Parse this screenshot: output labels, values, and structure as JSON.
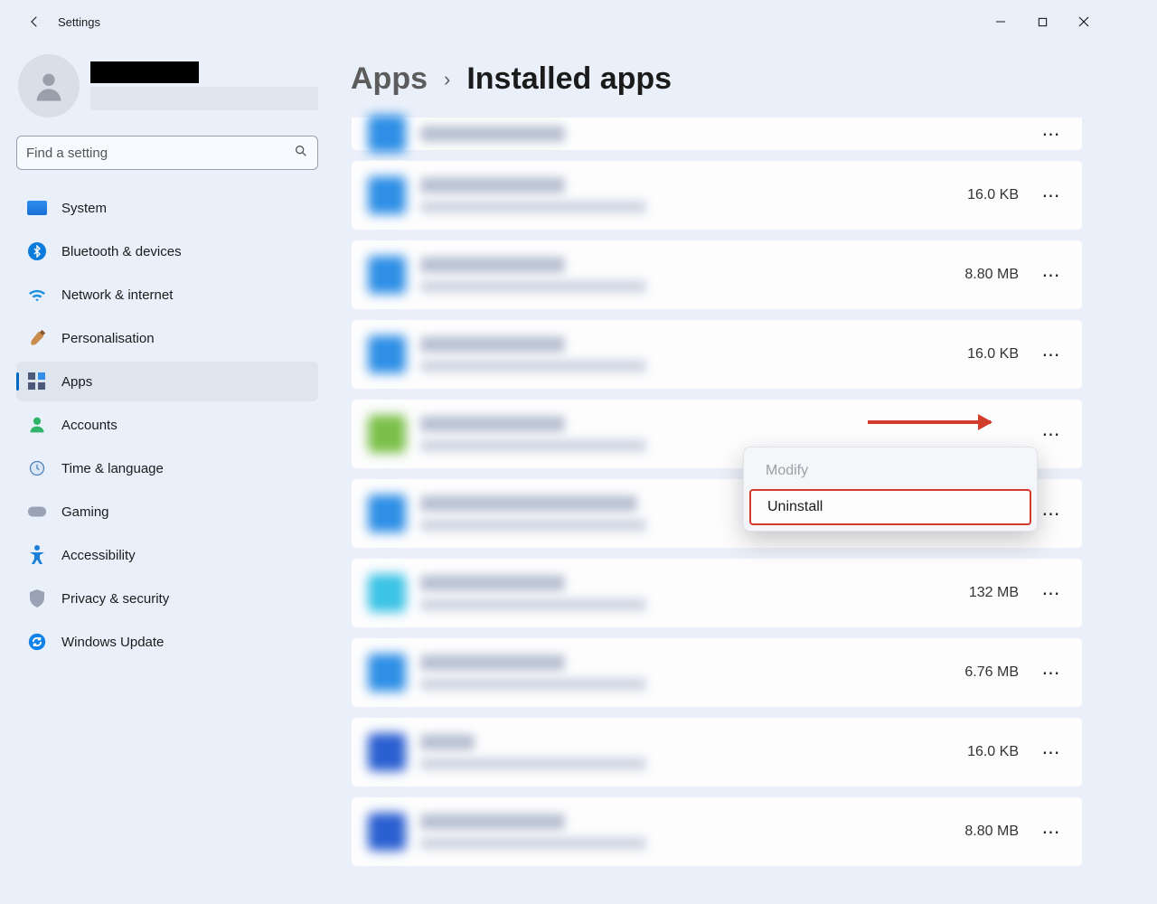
{
  "window": {
    "title": "Settings"
  },
  "search": {
    "placeholder": "Find a setting"
  },
  "nav": {
    "items": [
      {
        "label": "System"
      },
      {
        "label": "Bluetooth & devices"
      },
      {
        "label": "Network & internet"
      },
      {
        "label": "Personalisation"
      },
      {
        "label": "Apps"
      },
      {
        "label": "Accounts"
      },
      {
        "label": "Time & language"
      },
      {
        "label": "Gaming"
      },
      {
        "label": "Accessibility"
      },
      {
        "label": "Privacy & security"
      },
      {
        "label": "Windows Update"
      }
    ]
  },
  "breadcrumb": {
    "parent": "Apps",
    "current": "Installed apps"
  },
  "apps": [
    {
      "size": ""
    },
    {
      "size": "16.0 KB"
    },
    {
      "size": "8.80 MB"
    },
    {
      "size": "16.0 KB"
    },
    {
      "size": ""
    },
    {
      "size": ""
    },
    {
      "size": "132 MB"
    },
    {
      "size": "6.76 MB"
    },
    {
      "size": "16.0 KB"
    },
    {
      "size": "8.80 MB"
    }
  ],
  "context_menu": {
    "modify": "Modify",
    "uninstall": "Uninstall"
  }
}
